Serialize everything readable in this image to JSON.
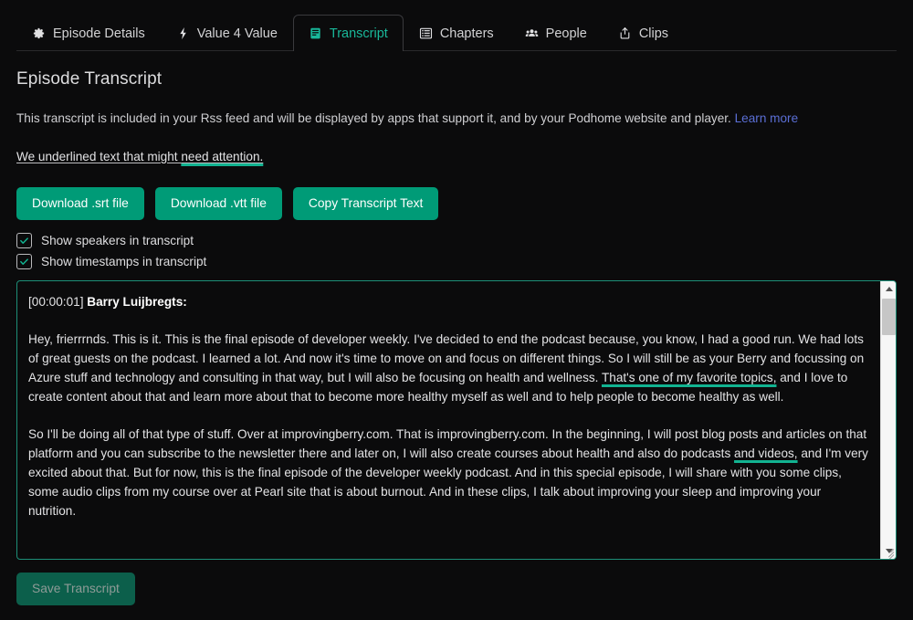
{
  "colors": {
    "background": "#0b0b0c",
    "accent_teal": "#009b77",
    "accent_active_tab": "#19b89a",
    "highlight_underline": "#12b391",
    "link_blue": "#5b6fd6",
    "save_disabled_bg": "#0c5f4b"
  },
  "tabs": [
    {
      "label": "Episode Details",
      "icon": "gear-icon",
      "active": false
    },
    {
      "label": "Value 4 Value",
      "icon": "lightning-bolt-icon",
      "active": false
    },
    {
      "label": "Transcript",
      "icon": "transcript-document-icon",
      "active": true
    },
    {
      "label": "Chapters",
      "icon": "list-icon",
      "active": false
    },
    {
      "label": "People",
      "icon": "people-icon",
      "active": false
    },
    {
      "label": "Clips",
      "icon": "share-upload-icon",
      "active": false
    }
  ],
  "page": {
    "title": "Episode Transcript",
    "description_text": "This transcript is included in your Rss feed and will be displayed by apps that support it, and by your Podhome website and player.",
    "learn_more_label": "Learn more",
    "attention_prefix": "We underlined text that might ",
    "attention_highlight": "need attention."
  },
  "buttons": {
    "download_srt": "Download .srt file",
    "download_vtt": "Download .vtt file",
    "copy_transcript": "Copy Transcript Text",
    "save_transcript": "Save Transcript"
  },
  "checkboxes": [
    {
      "label": "Show speakers in transcript",
      "checked": true
    },
    {
      "label": "Show timestamps in transcript",
      "checked": true
    }
  ],
  "transcript": {
    "timestamp": "[00:00:01]",
    "speaker": "Barry Luijbregts:",
    "paragraph1_before": "Hey, frierrrnds. This is it. This is the final episode of developer weekly. I've decided to end the podcast because, you know, I had a good run. We had lots of great guests on the podcast. I learned a lot. And now it's time to move on and focus on different things. So I will still be as your Berry and focussing on Azure stuff and technology and consulting in that way, but I will also be focusing on health and wellness. ",
    "paragraph1_highlight": "That's one of my favorite topics,",
    "paragraph1_after": " and I love to create content about that and learn more about that to become more healthy myself as well and to help people to become healthy as well.",
    "paragraph2_before": "So I'll be doing all of that type of stuff. Over at improvingberry.com. That is improvingberry.com. In the beginning, I will post blog posts and articles on that platform and you can subscribe to the newsletter there and later on, I will also create courses about health and also do podcasts ",
    "paragraph2_highlight": "and videos,",
    "paragraph2_after": " and I'm very excited about that. But for now, this is the final episode of the developer weekly podcast. And in this special episode, I will share with you some clips, some audio clips from my course over at Pearl site that is about burnout. And in these clips, I talk about improving your sleep and improving your nutrition."
  }
}
